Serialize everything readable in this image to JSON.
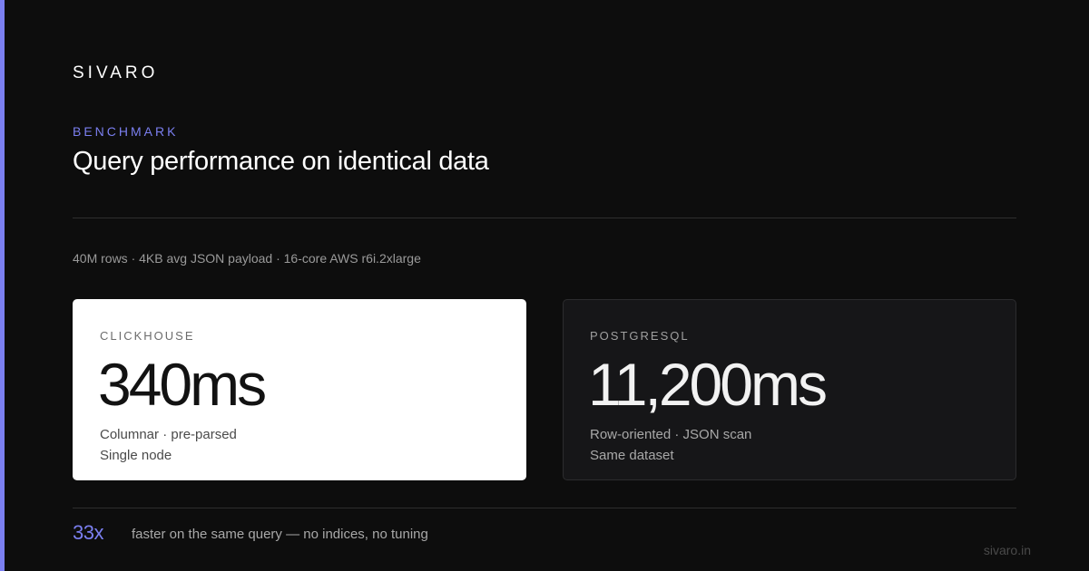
{
  "theme": {
    "accent": "#7b7ff0",
    "background": "#0d0d0d"
  },
  "brand": "SIVARO",
  "eyebrow": "BENCHMARK",
  "headline": "Query performance on identical data",
  "specs": "40M rows · 4KB avg JSON payload · 16-core AWS r6i.2xlarge",
  "cards": [
    {
      "label": "CLICKHOUSE",
      "value": "340ms",
      "line1": "Columnar · pre-parsed",
      "line2": "Single node"
    },
    {
      "label": "POSTGRESQL",
      "value": "11,200ms",
      "line1": "Row-oriented · JSON scan",
      "line2": "Same dataset"
    }
  ],
  "summary": {
    "multiplier": "33x",
    "tagline": "faster on the same query — no indices, no tuning"
  },
  "footer": {
    "domain": "sivaro.in"
  }
}
